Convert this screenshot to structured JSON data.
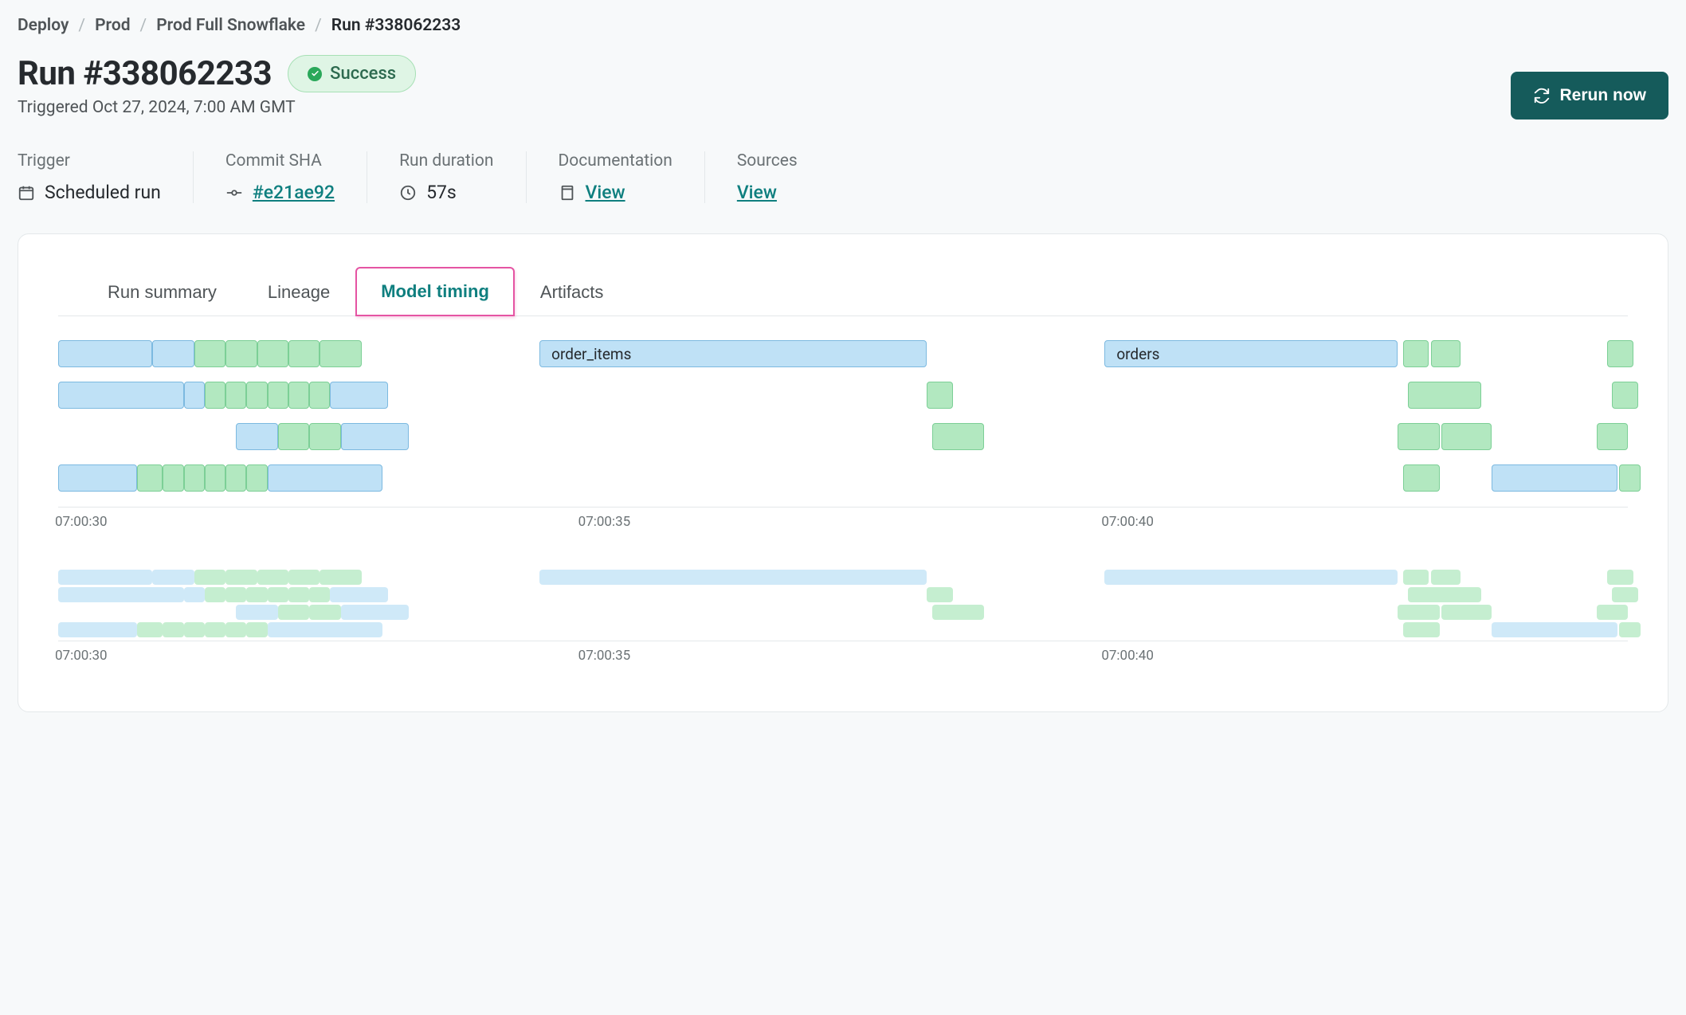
{
  "breadcrumb": {
    "items": [
      "Deploy",
      "Prod",
      "Prod Full Snowflake"
    ],
    "current": "Run #338062233"
  },
  "header": {
    "title": "Run #338062233",
    "status_label": "Success",
    "subtitle": "Triggered Oct 27, 2024, 7:00 AM GMT",
    "rerun_label": "Rerun now"
  },
  "info": {
    "trigger": {
      "label": "Trigger",
      "value": "Scheduled run"
    },
    "commit": {
      "label": "Commit SHA",
      "value": "#e21ae92"
    },
    "duration": {
      "label": "Run duration",
      "value": "57s"
    },
    "docs": {
      "label": "Documentation",
      "value": "View"
    },
    "sources": {
      "label": "Sources",
      "value": "View"
    }
  },
  "tabs": {
    "items": [
      "Run summary",
      "Lineage",
      "Model timing",
      "Artifacts"
    ],
    "active": "Model timing"
  },
  "chart_data": {
    "type": "gantt",
    "x_unit": "time_hms",
    "x_ticks": [
      "07:00:30",
      "07:00:35",
      "07:00:40"
    ],
    "x_range_seconds": [
      30,
      45
    ],
    "labeled_bars": {
      "order_items": {
        "row": 0,
        "start_s": 34.5,
        "end_s": 38.7,
        "kind": "model"
      },
      "orders": {
        "row": 0,
        "start_s": 40.0,
        "end_s": 42.8,
        "kind": "model"
      }
    },
    "rows": [
      [
        {
          "s": 30.0,
          "e": 30.9,
          "k": "blue"
        },
        {
          "s": 30.9,
          "e": 31.3,
          "k": "blue"
        },
        {
          "s": 31.3,
          "e": 31.6,
          "k": "green"
        },
        {
          "s": 31.6,
          "e": 31.9,
          "k": "green"
        },
        {
          "s": 31.9,
          "e": 32.2,
          "k": "green"
        },
        {
          "s": 32.2,
          "e": 32.5,
          "k": "green"
        },
        {
          "s": 32.5,
          "e": 32.9,
          "k": "green"
        },
        {
          "s": 34.6,
          "e": 38.3,
          "k": "blue",
          "label": "order_items"
        },
        {
          "s": 40.0,
          "e": 42.8,
          "k": "blue",
          "label": "orders"
        },
        {
          "s": 42.85,
          "e": 43.1,
          "k": "green"
        },
        {
          "s": 43.12,
          "e": 43.4,
          "k": "green"
        },
        {
          "s": 44.8,
          "e": 45.05,
          "k": "green"
        }
      ],
      [
        {
          "s": 30.0,
          "e": 31.2,
          "k": "blue"
        },
        {
          "s": 31.2,
          "e": 31.4,
          "k": "blue"
        },
        {
          "s": 31.4,
          "e": 31.6,
          "k": "green"
        },
        {
          "s": 31.6,
          "e": 31.8,
          "k": "green"
        },
        {
          "s": 31.8,
          "e": 32.0,
          "k": "green"
        },
        {
          "s": 32.0,
          "e": 32.2,
          "k": "green"
        },
        {
          "s": 32.2,
          "e": 32.4,
          "k": "green"
        },
        {
          "s": 32.4,
          "e": 32.6,
          "k": "green"
        },
        {
          "s": 32.6,
          "e": 33.15,
          "k": "blue"
        },
        {
          "s": 38.3,
          "e": 38.55,
          "k": "green"
        },
        {
          "s": 42.9,
          "e": 43.6,
          "k": "green"
        },
        {
          "s": 44.85,
          "e": 45.1,
          "k": "green"
        }
      ],
      [
        {
          "s": 31.7,
          "e": 32.1,
          "k": "blue"
        },
        {
          "s": 32.1,
          "e": 32.4,
          "k": "green"
        },
        {
          "s": 32.4,
          "e": 32.7,
          "k": "green"
        },
        {
          "s": 32.7,
          "e": 33.35,
          "k": "blue"
        },
        {
          "s": 38.35,
          "e": 38.85,
          "k": "green"
        },
        {
          "s": 42.8,
          "e": 43.2,
          "k": "green"
        },
        {
          "s": 43.22,
          "e": 43.7,
          "k": "green"
        },
        {
          "s": 44.7,
          "e": 45.0,
          "k": "green"
        }
      ],
      [
        {
          "s": 30.0,
          "e": 30.75,
          "k": "blue"
        },
        {
          "s": 30.75,
          "e": 31.0,
          "k": "green"
        },
        {
          "s": 31.0,
          "e": 31.2,
          "k": "green"
        },
        {
          "s": 31.2,
          "e": 31.4,
          "k": "green"
        },
        {
          "s": 31.4,
          "e": 31.6,
          "k": "green"
        },
        {
          "s": 31.6,
          "e": 31.8,
          "k": "green"
        },
        {
          "s": 31.8,
          "e": 32.0,
          "k": "green"
        },
        {
          "s": 32.0,
          "e": 33.1,
          "k": "blue"
        },
        {
          "s": 42.85,
          "e": 43.2,
          "k": "green"
        },
        {
          "s": 43.7,
          "e": 44.9,
          "k": "blue"
        },
        {
          "s": 44.92,
          "e": 45.12,
          "k": "green"
        }
      ]
    ]
  },
  "colors": {
    "model_bar": "#bfe1f6",
    "test_bar": "#b2e8c0",
    "active_tab_border": "#e554a3",
    "primary_button": "#155b5b"
  }
}
